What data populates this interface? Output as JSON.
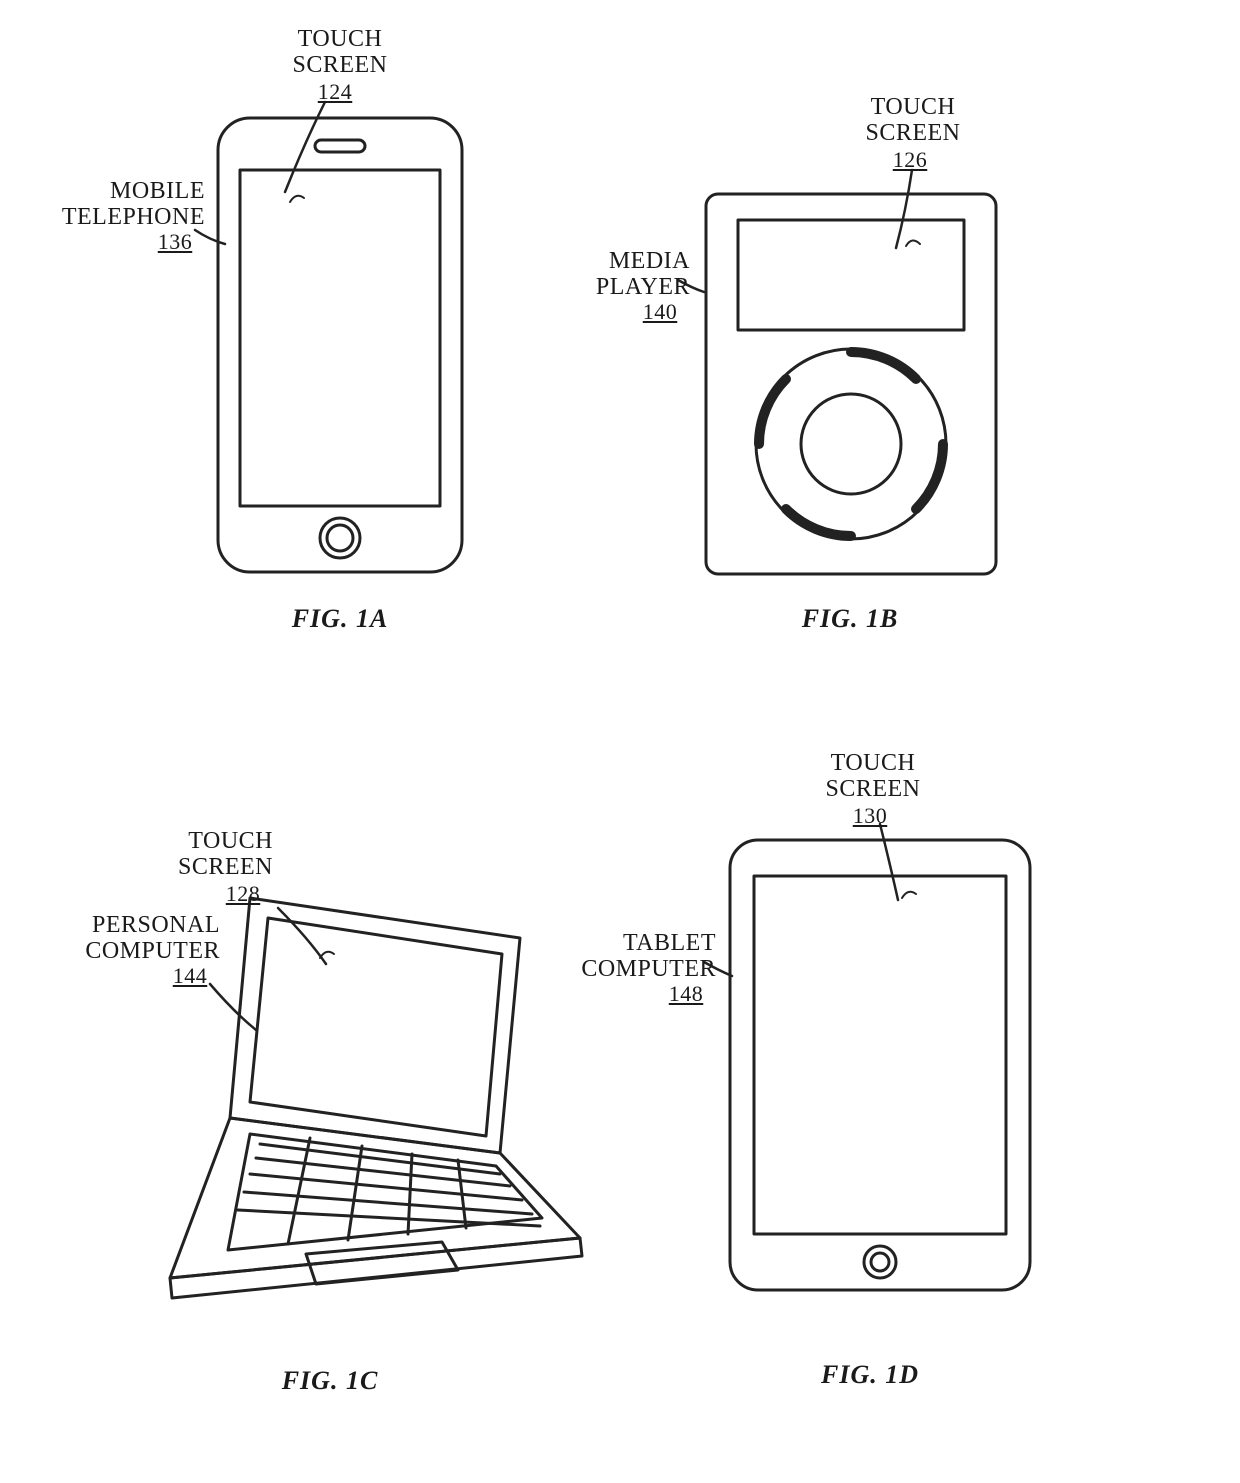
{
  "figures": {
    "fig1a": {
      "caption": "FIG. 1A",
      "ref_screen": {
        "label": "TOUCH\nSCREEN",
        "num": "124"
      },
      "ref_device": {
        "label": "MOBILE\nTELEPHONE",
        "num": "136"
      }
    },
    "fig1b": {
      "caption": "FIG. 1B",
      "ref_screen": {
        "label": "TOUCH\nSCREEN",
        "num": "126"
      },
      "ref_device": {
        "label": "MEDIA\nPLAYER",
        "num": "140"
      }
    },
    "fig1c": {
      "caption": "FIG. 1C",
      "ref_screen": {
        "label": "TOUCH\nSCREEN",
        "num": "128"
      },
      "ref_device": {
        "label": "PERSONAL\nCOMPUTER",
        "num": "144"
      }
    },
    "fig1d": {
      "caption": "FIG. 1D",
      "ref_screen": {
        "label": "TOUCH\nSCREEN",
        "num": "130"
      },
      "ref_device": {
        "label": "TABLET\nCOMPUTER",
        "num": "148"
      }
    }
  }
}
